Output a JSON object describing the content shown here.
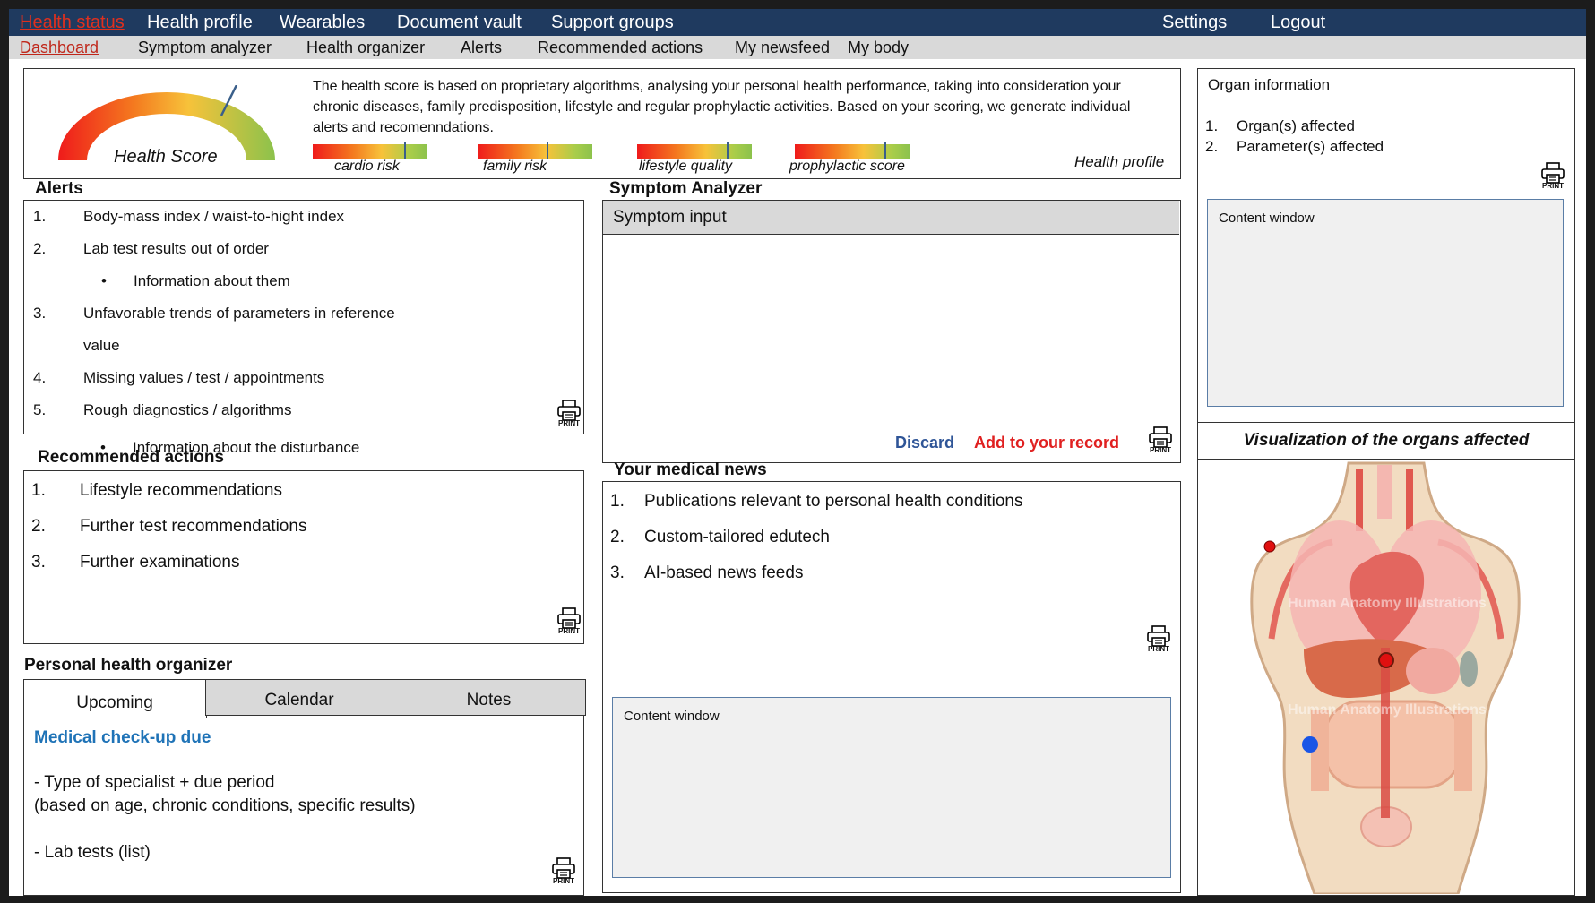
{
  "nav_primary": [
    "Health status",
    "Health profile",
    "Wearables",
    "Document vault",
    "Support groups",
    "Settings",
    "Logout"
  ],
  "nav_secondary": [
    "Dashboard",
    "Symptom analyzer",
    "Health organizer",
    "Alerts",
    "Recommended actions",
    "My newsfeed",
    "My body"
  ],
  "health_score": {
    "gauge_label": "Health Score",
    "description": "The health score is based on proprietary algorithms, analysing your personal health performance, taking into consideration your chronic diseases, family predisposition, lifestyle and regular prophylactic activities. Based on your scoring, we generate individual alerts and recomenndations.",
    "sub_scores": [
      {
        "label": "cardio risk",
        "level": 0.8
      },
      {
        "label": "family risk",
        "level": 0.6
      },
      {
        "label": "lifestyle quality",
        "level": 0.78
      },
      {
        "label": "prophylactic score",
        "level": 0.78
      }
    ],
    "profile_link": "Health profile",
    "gauge_level": 0.78
  },
  "alerts": {
    "title": "Alerts",
    "items": [
      {
        "num": "1.",
        "text": "Body-mass index / waist-to-hight index"
      },
      {
        "num": "2.",
        "text": "Lab test results out of order"
      },
      {
        "num": "•",
        "text": "Information about them"
      },
      {
        "num": "3.",
        "text": "Unfavorable trends of parameters in reference"
      },
      {
        "num": "",
        "text": "value"
      },
      {
        "num": "4.",
        "text": "Missing values / test / appointments"
      },
      {
        "num": "5.",
        "text": "Rough diagnostics / algorithms"
      },
      {
        "num": "•",
        "text": "Information about the disturbance"
      }
    ]
  },
  "recommended": {
    "title": "Recommended actions",
    "items": [
      {
        "num": "1.",
        "text": "Lifestyle recommendations"
      },
      {
        "num": "2.",
        "text": "Further test recommendations"
      },
      {
        "num": "3.",
        "text": "Further examinations"
      }
    ]
  },
  "organizer": {
    "title": "Personal health organizer",
    "tabs": [
      "Upcoming",
      "Calendar",
      "Notes"
    ],
    "headline": "Medical check-up due",
    "lines": [
      "-  Type of specialist + due period",
      "(based on age, chronic conditions, specific results)",
      "-  Lab tests (list)"
    ]
  },
  "symptom": {
    "title": "Symptom Analyzer",
    "input_label": "Symptom input",
    "discard": "Discard",
    "add": "Add to your record"
  },
  "news": {
    "title": "Your medical news",
    "items": [
      {
        "num": "1.",
        "text": "Publications relevant to personal health conditions"
      },
      {
        "num": "2.",
        "text": "Custom-tailored edutech"
      },
      {
        "num": "3.",
        "text": "AI-based news feeds"
      }
    ],
    "content_window": "Content window"
  },
  "organ": {
    "title": "Organ information",
    "items": [
      {
        "num": "1.",
        "text": "Organ(s) affected"
      },
      {
        "num": "2.",
        "text": "Parameter(s) affected"
      }
    ],
    "content_window": "Content window"
  },
  "visualization": {
    "title": "Visualization of the organs affected",
    "watermark": "Human Anatomy Illustrations"
  },
  "print_label": "PRINT",
  "colors": {
    "nav_bg": "#1f3a5f",
    "active_red": "#e0301e",
    "link_blue": "#1f73b7",
    "discard": "#2f5597",
    "add": "#e02020"
  }
}
